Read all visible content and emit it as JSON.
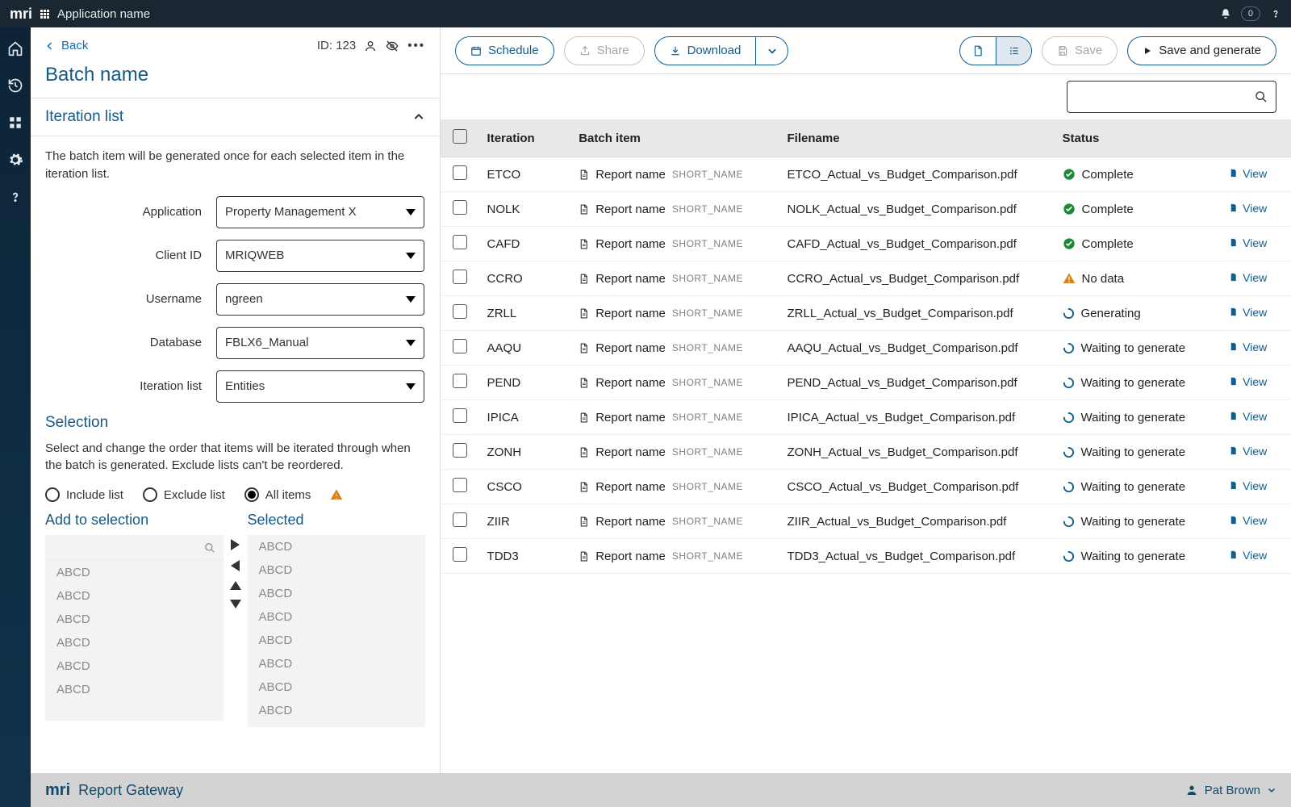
{
  "topbar": {
    "app_name": "Application name",
    "notif_count": "0"
  },
  "sidebar": {
    "items": [
      "home",
      "history",
      "grid",
      "settings",
      "help"
    ]
  },
  "left": {
    "back": "Back",
    "id_label": "ID: 123",
    "title": "Batch name",
    "iteration_header": "Iteration list",
    "iteration_desc": "The batch item will be generated once for each selected item in the iteration list.",
    "fields": {
      "application": {
        "label": "Application",
        "value": "Property Management X"
      },
      "client_id": {
        "label": "Client ID",
        "value": "MRIQWEB"
      },
      "username": {
        "label": "Username",
        "value": "ngreen"
      },
      "database": {
        "label": "Database",
        "value": "FBLX6_Manual"
      },
      "iteration": {
        "label": "Iteration list",
        "value": "Entities"
      }
    },
    "selection_header": "Selection",
    "selection_desc": "Select and change the order that items will be iterated through when the batch is generated. Exclude lists can't be reordered.",
    "radios": {
      "include": "Include list",
      "exclude": "Exclude list",
      "all": "All items"
    },
    "add_header": "Add to selection",
    "selected_header": "Selected",
    "placeholder_item": "ABCD",
    "add_items": [
      "ABCD",
      "ABCD",
      "ABCD",
      "ABCD",
      "ABCD",
      "ABCD"
    ],
    "selected_items": [
      "ABCD",
      "ABCD",
      "ABCD",
      "ABCD",
      "ABCD",
      "ABCD",
      "ABCD",
      "ABCD"
    ]
  },
  "toolbar": {
    "schedule": "Schedule",
    "share": "Share",
    "download": "Download",
    "save": "Save",
    "save_generate": "Save and generate"
  },
  "table": {
    "headers": {
      "iteration": "Iteration",
      "batch": "Batch item",
      "file": "Filename",
      "status": "Status"
    },
    "report_label": "Report name",
    "short_name": "SHORT_NAME",
    "view": "View",
    "status_labels": {
      "complete": "Complete",
      "nodata": "No data",
      "generating": "Generating",
      "waiting": "Waiting to generate"
    },
    "rows": [
      {
        "iter": "ETCO",
        "file": "ETCO_Actual_vs_Budget_Comparison.pdf",
        "status": "complete"
      },
      {
        "iter": "NOLK",
        "file": "NOLK_Actual_vs_Budget_Comparison.pdf",
        "status": "complete"
      },
      {
        "iter": "CAFD",
        "file": "CAFD_Actual_vs_Budget_Comparison.pdf",
        "status": "complete"
      },
      {
        "iter": "CCRO",
        "file": "CCRO_Actual_vs_Budget_Comparison.pdf",
        "status": "nodata"
      },
      {
        "iter": "ZRLL",
        "file": "ZRLL_Actual_vs_Budget_Comparison.pdf",
        "status": "generating"
      },
      {
        "iter": "AAQU",
        "file": "AAQU_Actual_vs_Budget_Comparison.pdf",
        "status": "waiting"
      },
      {
        "iter": "PEND",
        "file": "PEND_Actual_vs_Budget_Comparison.pdf",
        "status": "waiting"
      },
      {
        "iter": "IPICA",
        "file": "IPICA_Actual_vs_Budget_Comparison.pdf",
        "status": "waiting"
      },
      {
        "iter": "ZONH",
        "file": "ZONH_Actual_vs_Budget_Comparison.pdf",
        "status": "waiting"
      },
      {
        "iter": "CSCO",
        "file": "CSCO_Actual_vs_Budget_Comparison.pdf",
        "status": "waiting"
      },
      {
        "iter": "ZIIR",
        "file": "ZIIR_Actual_vs_Budget_Comparison.pdf",
        "status": "waiting"
      },
      {
        "iter": "TDD3",
        "file": "TDD3_Actual_vs_Budget_Comparison.pdf",
        "status": "waiting"
      }
    ]
  },
  "footer": {
    "gateway": "Report Gateway",
    "user": "Pat Brown"
  }
}
